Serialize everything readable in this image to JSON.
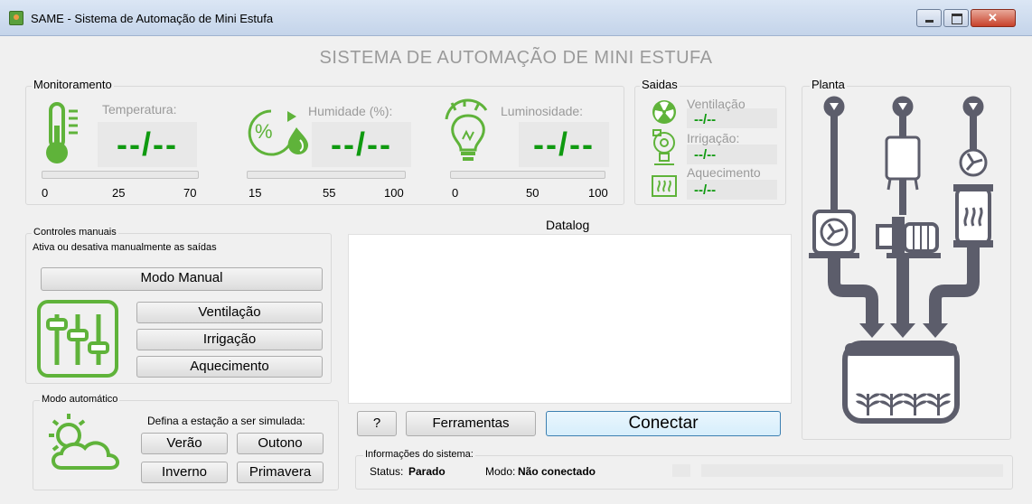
{
  "window": {
    "title": "SAME - Sistema de Automação de Mini Estufa"
  },
  "header": {
    "title": "SISTEMA DE AUTOMAÇÃO DE MINI ESTUFA"
  },
  "monitoramento": {
    "label": "Monitoramento",
    "sensors": [
      {
        "label": "Temperatura:",
        "value": "--/--",
        "ticks": [
          "0",
          "25",
          "70"
        ],
        "icon": "thermometer-icon"
      },
      {
        "label": "Humidade (%):",
        "value": "--/--",
        "ticks": [
          "15",
          "55",
          "100"
        ],
        "icon": "humidity-icon"
      },
      {
        "label": "Luminosidade:",
        "value": "--/--",
        "ticks": [
          "0",
          "50",
          "100"
        ],
        "icon": "lightbulb-icon"
      }
    ]
  },
  "saidas": {
    "label": "Saidas",
    "items": [
      {
        "label": "Ventilação",
        "value": "--/--",
        "icon": "fan-icon"
      },
      {
        "label": "Irrigação:",
        "value": "--/--",
        "icon": "pump-icon"
      },
      {
        "label": "Aquecimento",
        "value": "--/--",
        "icon": "heater-icon"
      }
    ]
  },
  "planta": {
    "label": "Planta"
  },
  "controles": {
    "label": "Controles manuais",
    "description": "Ativa ou desativa manualmente as saídas",
    "mode_button": "Modo Manual",
    "buttons": [
      "Ventilação",
      "Irrigação",
      "Aquecimento"
    ]
  },
  "datalog": {
    "label": "Datalog"
  },
  "automatico": {
    "label": "Modo automático",
    "prompt": "Defina a estação a ser simulada:",
    "seasons": [
      "Verão",
      "Outono",
      "Inverno",
      "Primavera"
    ]
  },
  "actions": {
    "help": "?",
    "tools": "Ferramentas",
    "connect": "Conectar"
  },
  "info": {
    "label": "Informações do sistema:",
    "status_key": "Status:",
    "status_value": "Parado",
    "mode_key": "Modo:",
    "mode_value": "Não conectado"
  },
  "colors": {
    "accent_green": "#0f9a10",
    "icon_green": "#5fb33a",
    "plant_gray": "#5c5d6b"
  }
}
